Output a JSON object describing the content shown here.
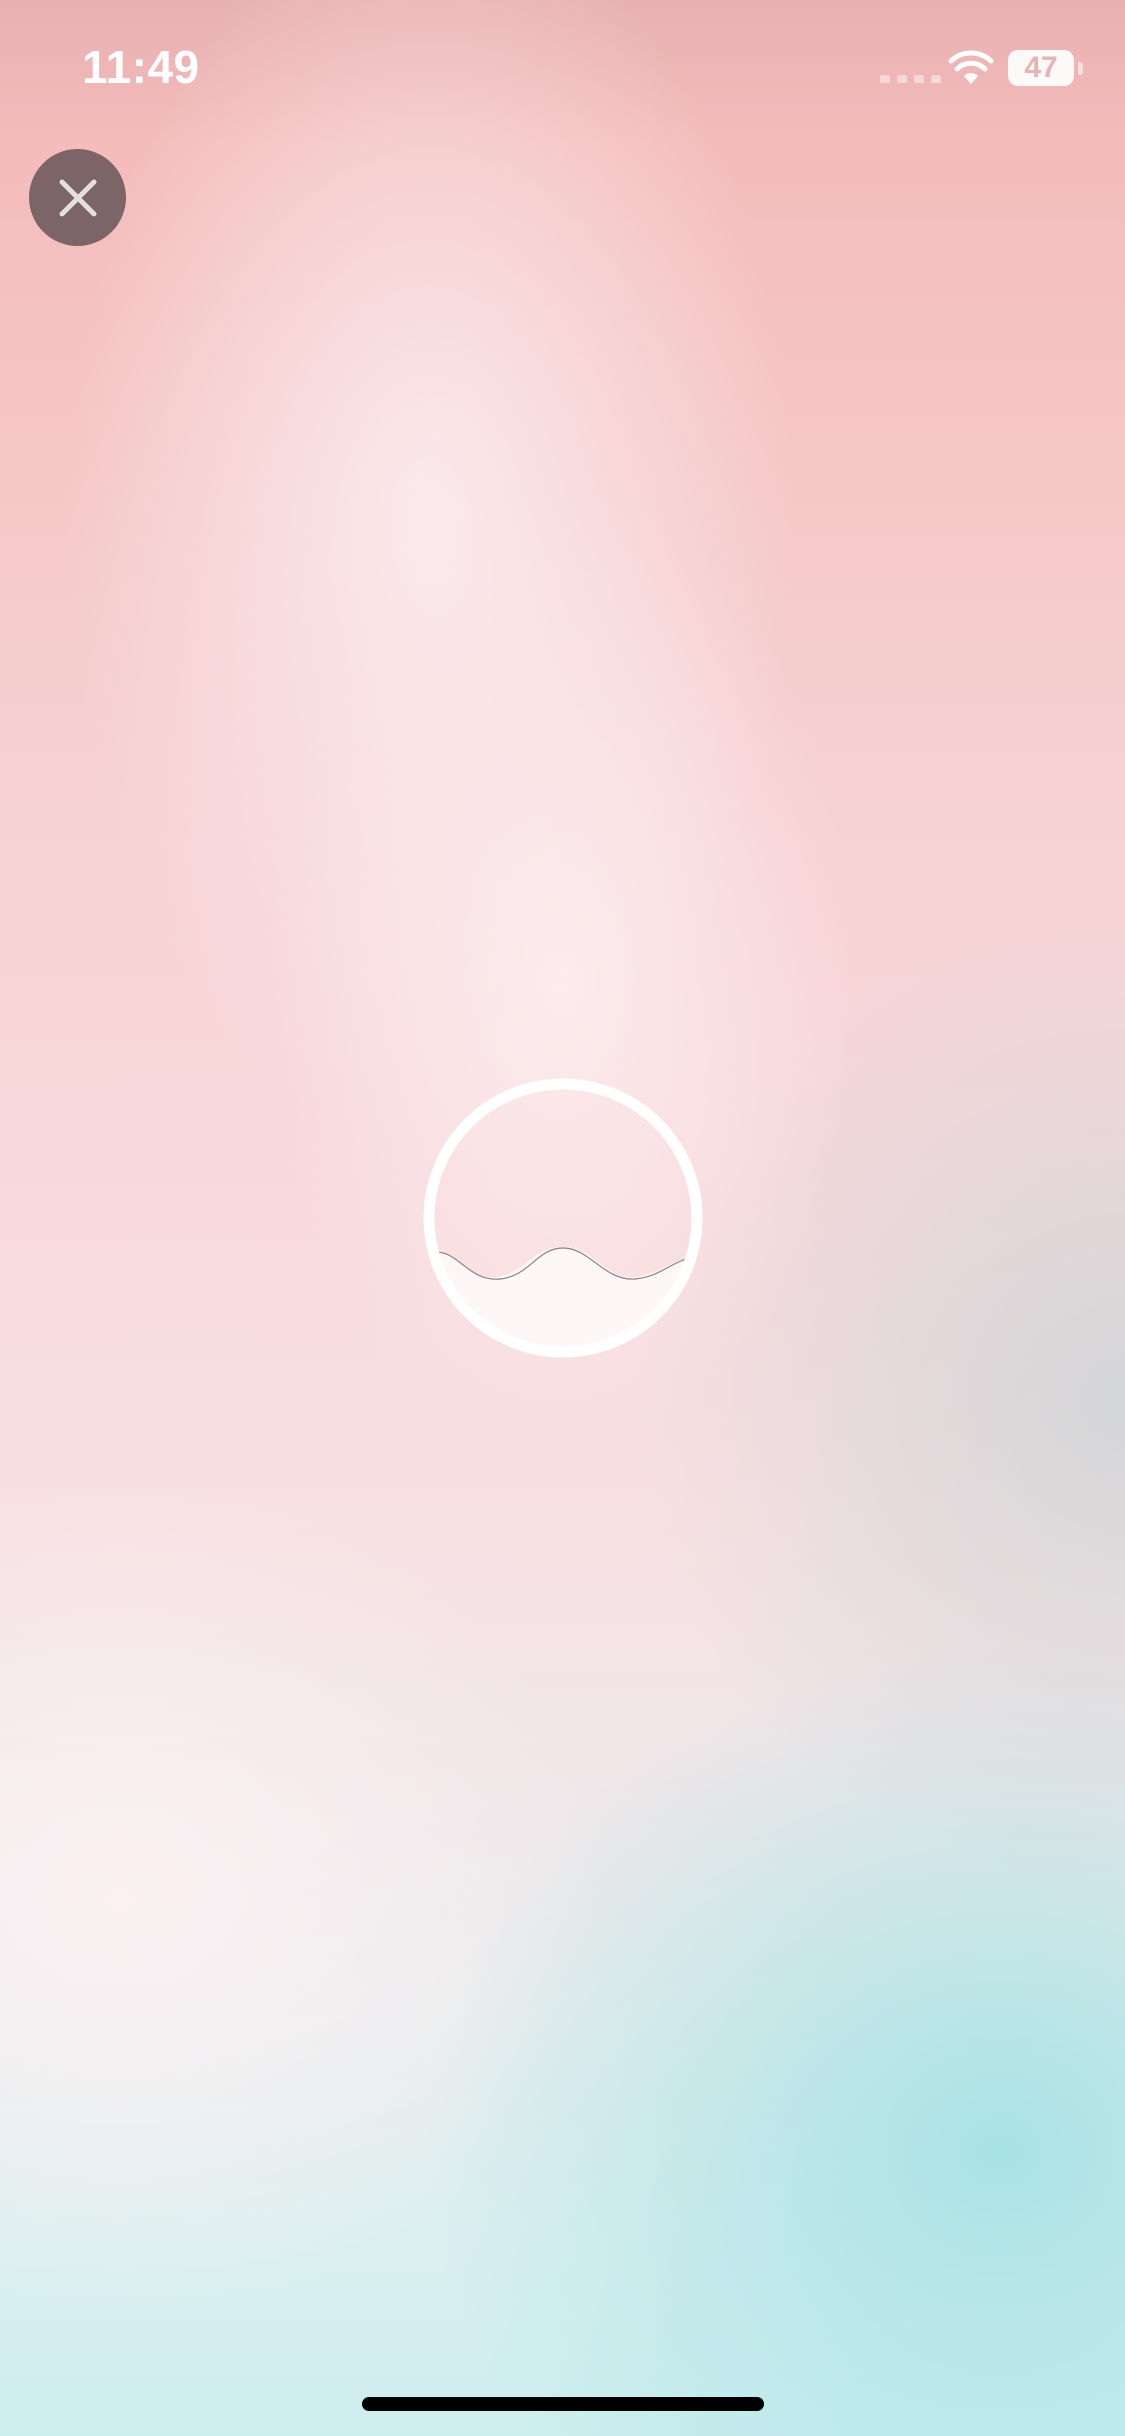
{
  "status_bar": {
    "time": "11:49",
    "battery_level": "47",
    "icons": [
      "cellular-signal-icon",
      "wifi-icon",
      "battery-icon"
    ]
  },
  "close_button": {
    "icon": "close-icon"
  },
  "loader": {
    "icon": "wave-progress-icon",
    "fill_fraction": 0.3
  },
  "colors": {
    "top_background": "#f4bcbb",
    "middle_background": "#f8dadc",
    "bottom_background": "#cdeeef",
    "close_button_bg": "#5a4b50",
    "loader_ring": "#ffffff"
  }
}
